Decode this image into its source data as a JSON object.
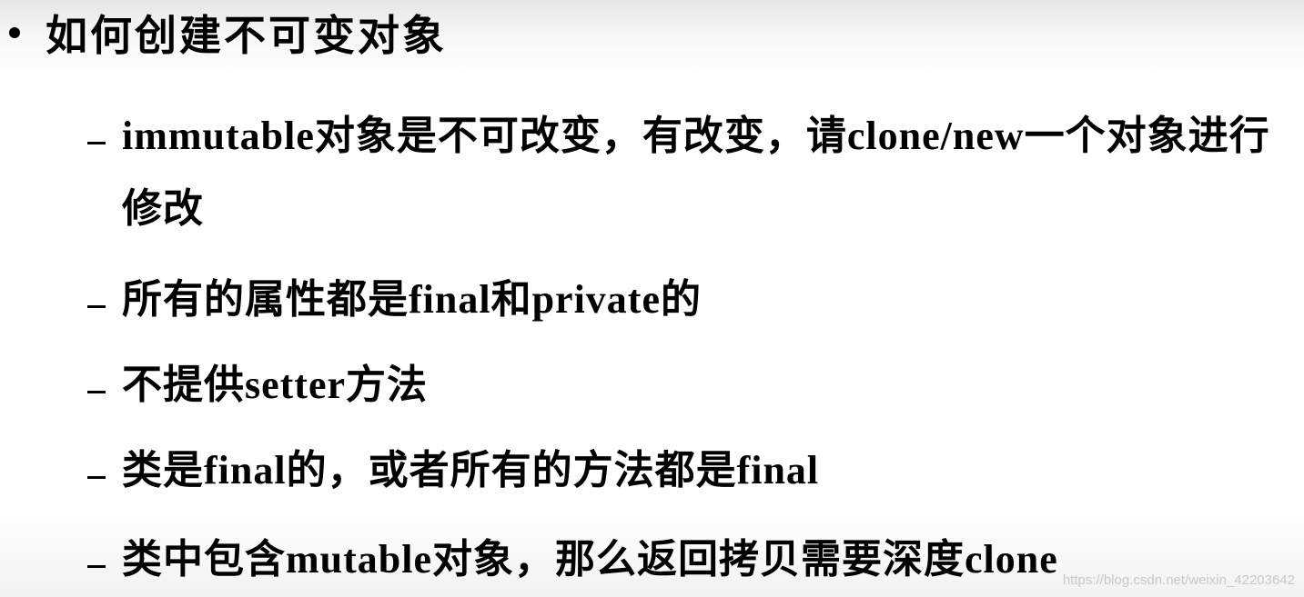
{
  "slide": {
    "title": "如何创建不可变对象",
    "items": [
      "immutable对象是不可改变，有改变，请clone/new一个对象进行修改",
      "所有的属性都是final和private的",
      "不提供setter方法",
      "类是final的，或者所有的方法都是final",
      "类中包含mutable对象，那么返回拷贝需要深度clone"
    ]
  },
  "watermark": "https://blog.csdn.net/weixin_42203642"
}
